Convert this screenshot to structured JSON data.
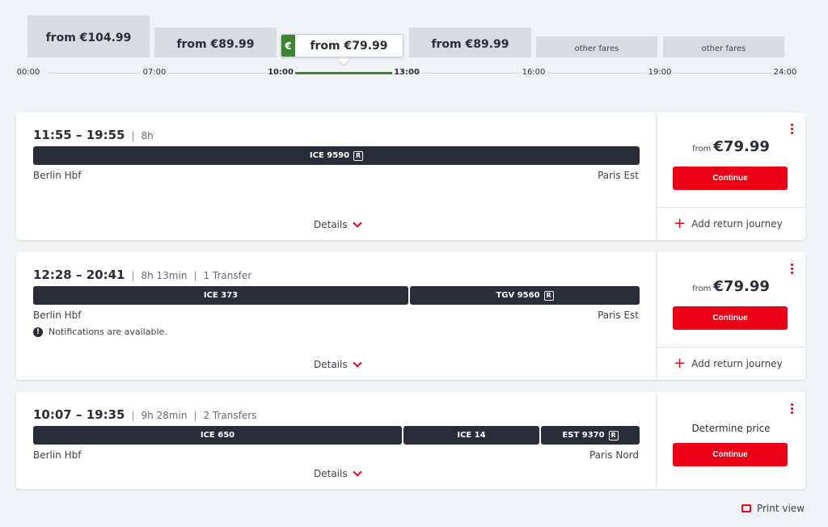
{
  "fare_chart": {
    "bars": [
      {
        "label": "from €104.99"
      },
      {
        "label": "from €89.99"
      },
      {
        "label": "from €79.99"
      },
      {
        "label": "from €89.99"
      },
      {
        "label": "other fares"
      },
      {
        "label": "other fares"
      }
    ],
    "selected_currency_symbol": "€",
    "ticks": [
      "00:00",
      "07:00",
      "10:00",
      "13:00",
      "16:00",
      "19:00",
      "24:00"
    ],
    "accent_color": "#408335"
  },
  "connections": [
    {
      "times": "11:55 – 19:55",
      "duration": "8h",
      "transfers": "",
      "segments": [
        {
          "name": "ICE 9590",
          "reservation": "R"
        }
      ],
      "from_station": "Berlin Hbf",
      "to_station": "Paris Est",
      "notification": "",
      "details_label": "Details",
      "price_prefix": "from",
      "price": "€79.99",
      "continue_label": "Continue",
      "return_label": "Add return journey"
    },
    {
      "times": "12:28 – 20:41",
      "duration": "8h 13min",
      "transfers": "1 Transfer",
      "segments": [
        {
          "name": "ICE 373"
        },
        {
          "name": "TGV 9560",
          "reservation": "R"
        }
      ],
      "from_station": "Berlin Hbf",
      "to_station": "Paris Est",
      "notification": "Notifications are available.",
      "details_label": "Details",
      "price_prefix": "from",
      "price": "€79.99",
      "continue_label": "Continue",
      "return_label": "Add return journey"
    },
    {
      "times": "10:07 – 19:35",
      "duration": "9h 28min",
      "transfers": "2 Transfers",
      "segments": [
        {
          "name": "ICE 650"
        },
        {
          "name": "ICE 14"
        },
        {
          "name": "EST 9370",
          "reservation": "R"
        }
      ],
      "from_station": "Berlin Hbf",
      "to_station": "Paris Nord",
      "notification": "",
      "details_label": "Details",
      "price_label": "Determine price",
      "continue_label": "Continue"
    }
  ],
  "footer": {
    "print_label": "Print view"
  },
  "colors": {
    "brand_red": "#ec0016",
    "train_bar": "#282d37",
    "background": "#f0f3f5"
  }
}
